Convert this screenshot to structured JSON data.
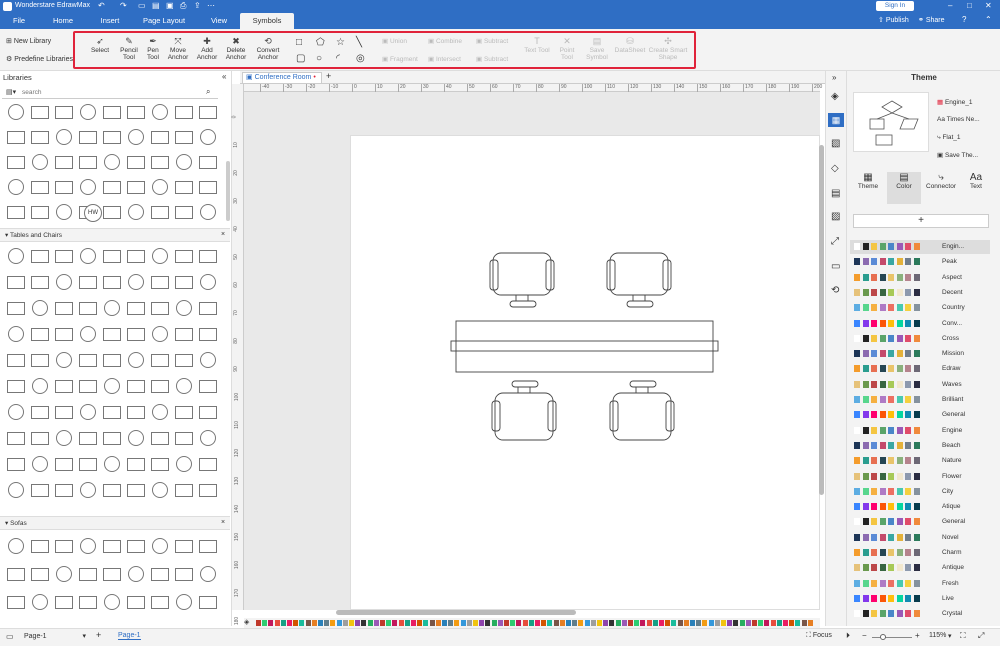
{
  "app_title": "Wonderstare EdrawMax",
  "title_actions": {
    "sign_in": "Sign In",
    "publish": "Publish",
    "share": "Share"
  },
  "menu_tabs": [
    "File",
    "Home",
    "Insert",
    "Page Layout",
    "View",
    "Symbols"
  ],
  "toolbar": {
    "new_library": "New Library",
    "predefine_libraries": "Predefine Libraries",
    "tools": [
      {
        "label": "Select",
        "icon": "select-arrow-icon",
        "enabled": true
      },
      {
        "label": "Pencil Tool",
        "icon": "pencil-icon",
        "enabled": true
      },
      {
        "label": "Pen Tool",
        "icon": "pen-icon",
        "enabled": true
      },
      {
        "label": "Move Anchor",
        "icon": "move-anchor-icon",
        "enabled": true
      },
      {
        "label": "Add Anchor",
        "icon": "add-anchor-icon",
        "enabled": true
      },
      {
        "label": "Delete Anchor",
        "icon": "delete-anchor-icon",
        "enabled": true
      },
      {
        "label": "Convert Anchor",
        "icon": "convert-anchor-icon",
        "enabled": true
      }
    ],
    "boolean_ops": [
      "Union",
      "Combine",
      "Subtract",
      "Fragment",
      "Intersect",
      "Subtract"
    ],
    "disabled_tools": [
      "Text Tool",
      "Point Tool",
      "Save Symbol",
      "DataSheet",
      "Create Smart Shape"
    ]
  },
  "libraries": {
    "title": "Libraries",
    "search_placeholder": "search",
    "sections": [
      "Tables and Chairs",
      "Sofas"
    ],
    "hw_label": "HW"
  },
  "document_tab": "Conference Room",
  "ruler_ticks": [
    "-40",
    "-30",
    "-20",
    "-10",
    "0",
    "10",
    "20",
    "30",
    "40",
    "50",
    "60",
    "70",
    "80",
    "90",
    "100",
    "110",
    "120",
    "130",
    "140",
    "150",
    "160",
    "170",
    "180",
    "190",
    "200"
  ],
  "vruler_ticks": [
    "0",
    "10",
    "20",
    "30",
    "40",
    "50",
    "60",
    "70",
    "80",
    "90",
    "100",
    "110",
    "120",
    "130",
    "140",
    "150",
    "160",
    "170",
    "180"
  ],
  "right_panel": {
    "title": "Theme",
    "theme_info": [
      "Engine_1",
      "Times Ne...",
      "Flat_1",
      "Save The..."
    ],
    "tabs": [
      "Theme",
      "Color",
      "Connector",
      "Text"
    ],
    "themes": [
      "Engin...",
      "Peak",
      "Aspect",
      "Decent",
      "Country",
      "Conv...",
      "Cross",
      "Mission",
      "Edraw",
      "Waves",
      "Brilliant",
      "General",
      "Engine",
      "Beach",
      "Nature",
      "Flower",
      "City",
      "Atique",
      "General",
      "Novel",
      "Charm",
      "Antique",
      "Fresh",
      "Live",
      "Crystal"
    ]
  },
  "status": {
    "page_select": "Page-1",
    "page_tab": "Page-1",
    "focus": "Focus",
    "zoom": "115%"
  },
  "theme_palettes": [
    [
      "#ffffff",
      "#222222",
      "#f4c542",
      "#5aa469",
      "#4a86c8",
      "#9b59b6",
      "#e04c6a",
      "#f08a3c"
    ],
    [
      "#1d3557",
      "#8c6bb1",
      "#5b8bd6",
      "#c44a6b",
      "#3aa7a3",
      "#e4b23a",
      "#6f7d8c",
      "#2c7a5b"
    ],
    [
      "#f49c2c",
      "#2a9d8f",
      "#e76f51",
      "#264653",
      "#e9c46a",
      "#8ab17d",
      "#b5838d",
      "#6d6875"
    ],
    [
      "#e6c27a",
      "#6a994e",
      "#bc4749",
      "#386641",
      "#a7c957",
      "#f2e8cf",
      "#8d99ae",
      "#2b2d42"
    ],
    [
      "#5dade2",
      "#58d68d",
      "#f5b041",
      "#af7ac5",
      "#ec7063",
      "#48c9b0",
      "#f4d03f",
      "#85929e"
    ],
    [
      "#3a86ff",
      "#8338ec",
      "#ff006e",
      "#fb5607",
      "#ffbe0b",
      "#06d6a0",
      "#118ab2",
      "#073b4c"
    ]
  ]
}
